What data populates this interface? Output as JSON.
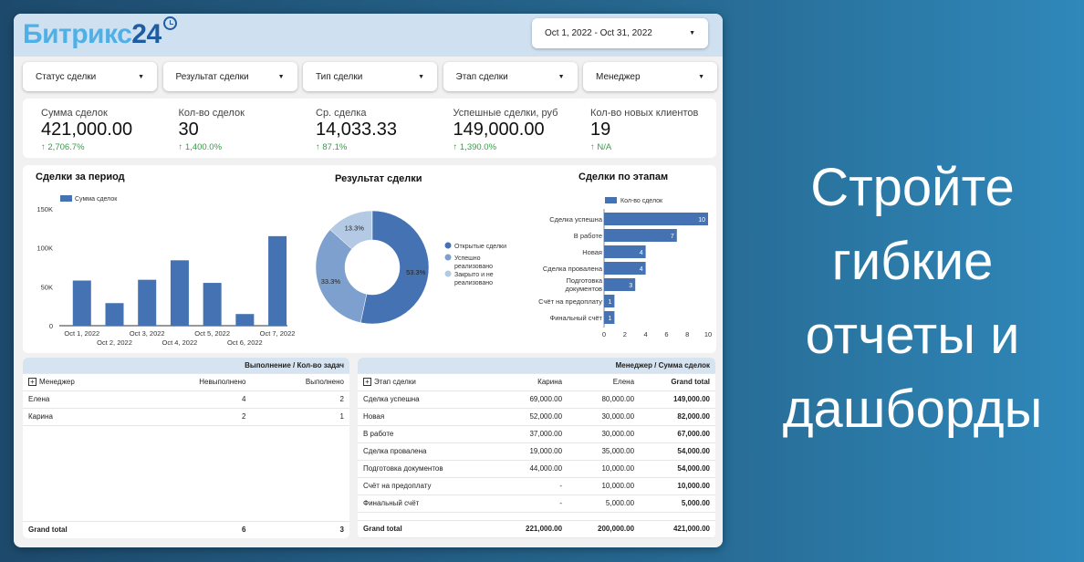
{
  "logo": {
    "text": "Битрикс",
    "num": "24"
  },
  "date_range": "Oct 1, 2022 - Oct 31, 2022",
  "filters": [
    "Статус сделки",
    "Результат сделки",
    "Тип сделки",
    "Этап сделки",
    "Менеджер"
  ],
  "kpis": [
    {
      "label": "Сумма сделок",
      "value": "421,000.00",
      "delta": "2,706.7%"
    },
    {
      "label": "Кол-во сделок",
      "value": "30",
      "delta": "1,400.0%"
    },
    {
      "label": "Ср. сделка",
      "value": "14,033.33",
      "delta": "87.1%"
    },
    {
      "label": "Успешные сделки, руб",
      "value": "149,000.00",
      "delta": "1,390.0%"
    },
    {
      "label": "Кол-во новых клиентов",
      "value": "19",
      "delta": "N/A"
    }
  ],
  "colors": {
    "primary": "#4472b3",
    "mid": "#7da0cf",
    "light": "#b4c9e4",
    "positive": "#3a9a4a"
  },
  "chart_data": [
    {
      "type": "bar",
      "title": "Сделки за период",
      "legend": "Сумма сделок",
      "categories": [
        "Oct 1, 2022",
        "Oct 2, 2022",
        "Oct 3, 2022",
        "Oct 4, 2022",
        "Oct 5, 2022",
        "Oct 6, 2022",
        "Oct 7, 2022"
      ],
      "values": [
        58000,
        29000,
        59000,
        84000,
        55000,
        15000,
        115000
      ],
      "yticks": [
        "0",
        "50K",
        "100K",
        "150K"
      ],
      "ylim": [
        0,
        150000
      ]
    },
    {
      "type": "pie",
      "title": "Результат сделки",
      "labels": [
        "Открытые сделки",
        "Успешно реализовано",
        "Закрыто и не реализовано"
      ],
      "values": [
        53.3,
        33.3,
        13.3
      ],
      "value_labels": [
        "53.3%",
        "33.3%",
        "13.3%"
      ]
    },
    {
      "type": "bar",
      "orientation": "horizontal",
      "title": "Сделки по этапам",
      "legend": "Кол-во сделок",
      "categories": [
        "Сделка успешна",
        "В работе",
        "Новая",
        "Сделка провалена",
        "Подготовка документов",
        "Счёт на предоплату",
        "Финальный счёт"
      ],
      "values": [
        10,
        7,
        4,
        4,
        3,
        1,
        1
      ],
      "xticks": [
        "0",
        "2",
        "4",
        "6",
        "8",
        "10"
      ],
      "xlim": [
        0,
        10
      ]
    }
  ],
  "table1": {
    "header": "Выполнение / Кол-во задач",
    "cols": [
      "Менеджер",
      "Невыполнено",
      "Выполнено"
    ],
    "rows": [
      [
        "Елена",
        "4",
        "2"
      ],
      [
        "Карина",
        "2",
        "1"
      ]
    ],
    "total": [
      "Grand total",
      "6",
      "3"
    ]
  },
  "table2": {
    "header": "Менеджер / Сумма сделок",
    "cols": [
      "Этап сделки",
      "Карина",
      "Елена",
      "Grand total"
    ],
    "rows": [
      [
        "Сделка успешна",
        "69,000.00",
        "80,000.00",
        "149,000.00"
      ],
      [
        "Новая",
        "52,000.00",
        "30,000.00",
        "82,000.00"
      ],
      [
        "В работе",
        "37,000.00",
        "30,000.00",
        "67,000.00"
      ],
      [
        "Сделка провалена",
        "19,000.00",
        "35,000.00",
        "54,000.00"
      ],
      [
        "Подготовка документов",
        "44,000.00",
        "10,000.00",
        "54,000.00"
      ],
      [
        "Счёт на предоплату",
        "-",
        "10,000.00",
        "10,000.00"
      ],
      [
        "Финальный счёт",
        "-",
        "5,000.00",
        "5,000.00"
      ]
    ],
    "total": [
      "Grand total",
      "221,000.00",
      "200,000.00",
      "421,000.00"
    ]
  },
  "slogan": [
    "Стройте",
    "гибкие",
    "отчеты и",
    "дашборды"
  ]
}
